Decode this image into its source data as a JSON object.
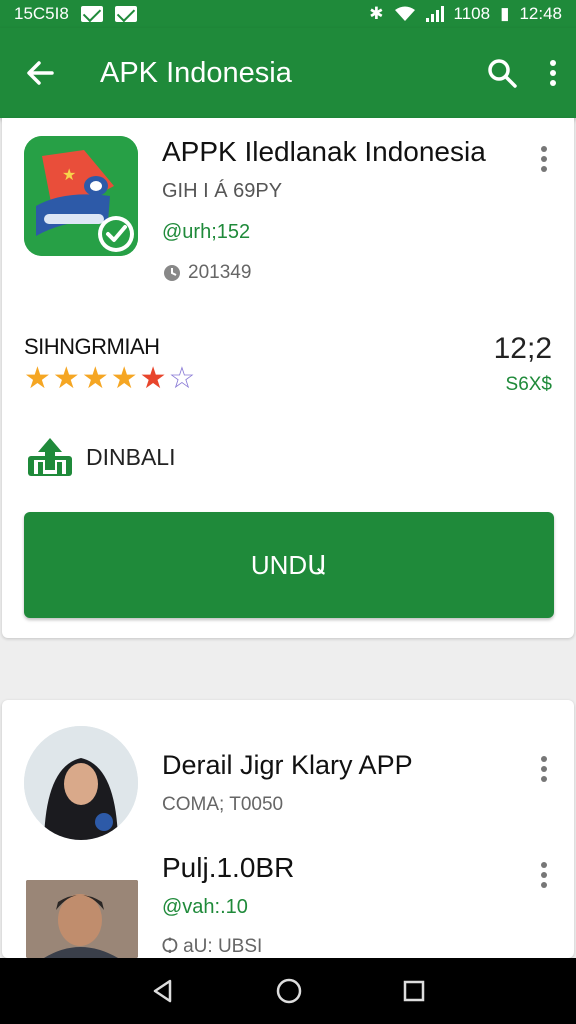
{
  "status_bar": {
    "time_left": "15C5I8",
    "battery": "1108",
    "clock": "12:48"
  },
  "app_bar": {
    "title": "APK Indonesia"
  },
  "app_card": {
    "name": "APPK Iledlanak Indonesia",
    "developer": "GIH I Á 69PY",
    "version": "@urh;152",
    "size": "201349",
    "rating_label": "SIHNGRMIAH",
    "rating_value": "12;2",
    "rating_sub": "S6X$",
    "stars": 4.5,
    "download_label": "DINBALI",
    "install_label": "UNDԱ"
  },
  "list": [
    {
      "title": "Derail Jigr Klary APP",
      "sub": "COMA; T0050"
    },
    {
      "title": "Pulj.1.0BR",
      "sub": "@vah:.10",
      "sub2": "Ѻ aU: UBSI"
    }
  ],
  "colors": {
    "primary": "#1f8a3a",
    "star": "#f5a623"
  }
}
